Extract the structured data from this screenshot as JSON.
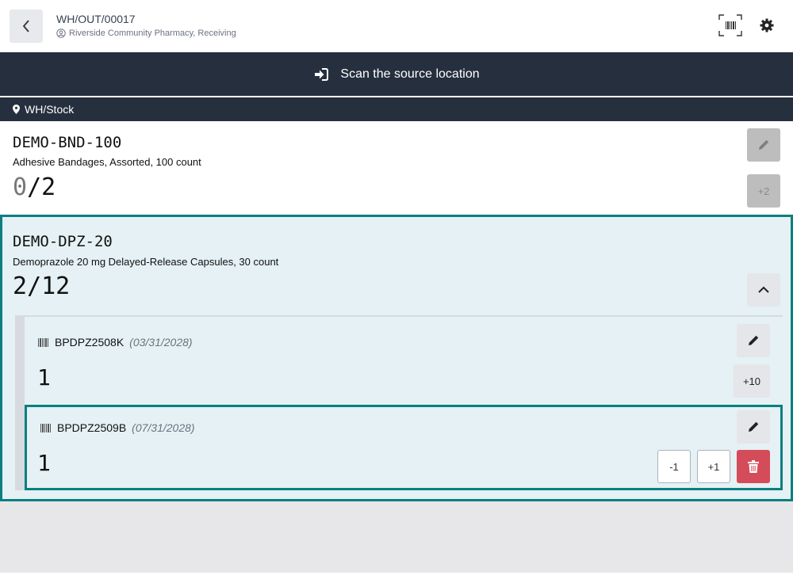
{
  "header": {
    "reference": "WH/OUT/00017",
    "partner": "Riverside Community Pharmacy, Receiving"
  },
  "banner": {
    "instruction": "Scan the source location"
  },
  "location": {
    "name": "WH/Stock"
  },
  "lines": [
    {
      "code": "DEMO-BND-100",
      "name": "Adhesive Bandages, Assorted, 100 count",
      "qty_done": "0",
      "qty_total": "/2",
      "increment_label": "+2"
    },
    {
      "code": "DEMO-DPZ-20",
      "name": "Demoprazole 20 mg Delayed-Release Capsules, 30 count",
      "qty_done": "2",
      "qty_total": "/12",
      "lots": [
        {
          "lot": "BPDPZ2508K",
          "expiry": "(03/31/2028)",
          "qty": "1",
          "increment_label": "+10"
        },
        {
          "lot": "BPDPZ2509B",
          "expiry": "(07/31/2028)",
          "qty": "1",
          "minus_label": "-1",
          "plus_label": "+1"
        }
      ]
    }
  ],
  "colors": {
    "accent": "#0b7f80",
    "banner": "#262f3e",
    "danger": "#d44c59",
    "selected_bg": "#e5f1f4"
  }
}
